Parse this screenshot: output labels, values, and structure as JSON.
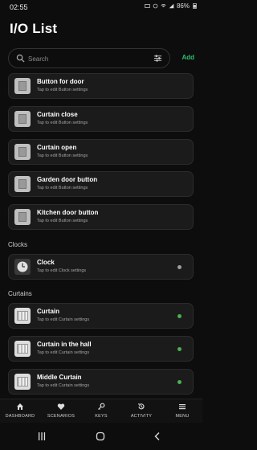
{
  "status": {
    "time": "02:55",
    "battery": "86%"
  },
  "header": {
    "title": "I/O List"
  },
  "search": {
    "placeholder": "Search",
    "value": ""
  },
  "add_label": "Add",
  "colors": {
    "accent": "#2fbf71",
    "dot_active": "#4caf50",
    "dot_inactive": "#9e9e9e"
  },
  "sections": [
    {
      "title": "",
      "items": [
        {
          "name": "Button for door",
          "sub": "Tap to edit Button settings",
          "icon": "button-device-icon"
        },
        {
          "name": "Curtain close",
          "sub": "Tap to edit Button settings",
          "icon": "button-device-icon"
        },
        {
          "name": "Curtain open",
          "sub": "Tap to edit Button settings",
          "icon": "button-device-icon"
        },
        {
          "name": "Garden door button",
          "sub": "Tap to edit Button settings",
          "icon": "button-device-icon"
        },
        {
          "name": "Kitchen door button",
          "sub": "Tap to edit Button settings",
          "icon": "button-device-icon"
        }
      ]
    },
    {
      "title": "Clocks",
      "items": [
        {
          "name": "Clock",
          "sub": "Tap to edit Clock settings",
          "icon": "clock-icon",
          "status": "inactive"
        }
      ]
    },
    {
      "title": "Curtains",
      "items": [
        {
          "name": "Curtain",
          "sub": "Tap to edit Curtain settings",
          "icon": "curtain-icon",
          "status": "active"
        },
        {
          "name": "Curtain in the hall",
          "sub": "Tap to edit Curtain settings",
          "icon": "curtain-icon",
          "status": "active"
        },
        {
          "name": "Middle Curtain",
          "sub": "Tap to edit Curtain settings",
          "icon": "curtain-icon",
          "status": "active"
        }
      ]
    }
  ],
  "bottom_nav": [
    {
      "label": "DASHBOARD",
      "icon": "home-icon"
    },
    {
      "label": "SCENARIOS",
      "icon": "heart-icon"
    },
    {
      "label": "KEYS",
      "icon": "key-icon"
    },
    {
      "label": "ACTIVITY",
      "icon": "history-icon"
    },
    {
      "label": "MENU",
      "icon": "menu-icon"
    }
  ]
}
